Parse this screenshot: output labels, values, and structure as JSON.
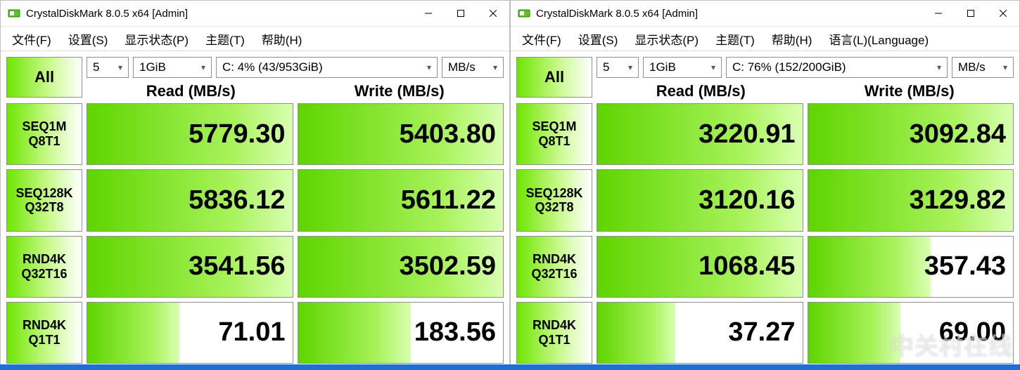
{
  "windows": [
    {
      "title": "CrystalDiskMark 8.0.5 x64 [Admin]",
      "menus": [
        "文件(F)",
        "设置(S)",
        "显示状态(P)",
        "主题(T)",
        "帮助(H)"
      ],
      "all_button": "All",
      "runs": "5",
      "size": "1GiB",
      "drive": "C: 4% (43/953GiB)",
      "unit": "MB/s",
      "read_header": "Read (MB/s)",
      "write_header": "Write (MB/s)",
      "rows": [
        {
          "label1": "SEQ1M",
          "label2": "Q8T1",
          "read": "5779.30",
          "read_fill": 100,
          "write": "5403.80",
          "write_fill": 100
        },
        {
          "label1": "SEQ128K",
          "label2": "Q32T8",
          "read": "5836.12",
          "read_fill": 100,
          "write": "5611.22",
          "write_fill": 100
        },
        {
          "label1": "RND4K",
          "label2": "Q32T16",
          "read": "3541.56",
          "read_fill": 100,
          "write": "3502.59",
          "write_fill": 100
        },
        {
          "label1": "RND4K",
          "label2": "Q1T1",
          "read": "71.01",
          "read_fill": 45,
          "write": "183.56",
          "write_fill": 55
        }
      ]
    },
    {
      "title": "CrystalDiskMark 8.0.5 x64 [Admin]",
      "menus": [
        "文件(F)",
        "设置(S)",
        "显示状态(P)",
        "主题(T)",
        "帮助(H)",
        "语言(L)(Language)"
      ],
      "all_button": "All",
      "runs": "5",
      "size": "1GiB",
      "drive": "C: 76% (152/200GiB)",
      "unit": "MB/s",
      "read_header": "Read (MB/s)",
      "write_header": "Write (MB/s)",
      "rows": [
        {
          "label1": "SEQ1M",
          "label2": "Q8T1",
          "read": "3220.91",
          "read_fill": 100,
          "write": "3092.84",
          "write_fill": 100
        },
        {
          "label1": "SEQ128K",
          "label2": "Q32T8",
          "read": "3120.16",
          "read_fill": 100,
          "write": "3129.82",
          "write_fill": 100
        },
        {
          "label1": "RND4K",
          "label2": "Q32T16",
          "read": "1068.45",
          "read_fill": 100,
          "write": "357.43",
          "write_fill": 60
        },
        {
          "label1": "RND4K",
          "label2": "Q1T1",
          "read": "37.27",
          "read_fill": 38,
          "write": "69.00",
          "write_fill": 45
        }
      ]
    }
  ],
  "watermark": "中关村在线",
  "chart_data": {
    "type": "table",
    "title": "CrystalDiskMark 8.0.5 results (MB/s)",
    "series": [
      {
        "name": "Drive C 43/953GiB",
        "tests": [
          "SEQ1M Q8T1",
          "SEQ128K Q32T8",
          "RND4K Q32T16",
          "RND4K Q1T1"
        ],
        "read": [
          5779.3,
          5836.12,
          3541.56,
          71.01
        ],
        "write": [
          5403.8,
          5611.22,
          3502.59,
          183.56
        ]
      },
      {
        "name": "Drive C 152/200GiB",
        "tests": [
          "SEQ1M Q8T1",
          "SEQ128K Q32T8",
          "RND4K Q32T16",
          "RND4K Q1T1"
        ],
        "read": [
          3220.91,
          3120.16,
          1068.45,
          37.27
        ],
        "write": [
          3092.84,
          3129.82,
          357.43,
          69.0
        ]
      }
    ]
  }
}
